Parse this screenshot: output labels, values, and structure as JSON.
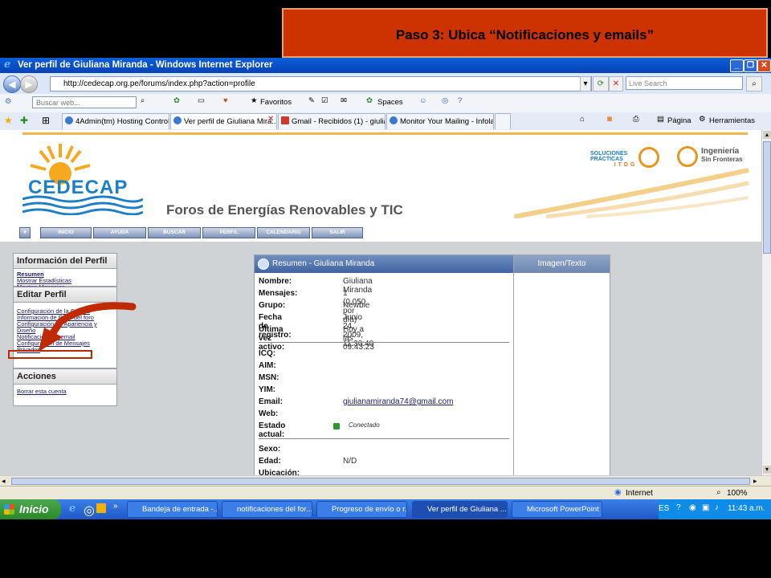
{
  "banner": {
    "text": "Paso 3: Ubica “Notificaciones y emails”"
  },
  "window": {
    "title": "Ver perfil de Giuliana Miranda - Windows Internet Explorer"
  },
  "address": {
    "url": "http://cedecap.org.pe/forums/index.php?action=profile",
    "search_placeholder": "Live Search"
  },
  "toolbar": {
    "search_placeholder": "Buscar web...",
    "favoritos": "Favoritos",
    "spaces": "Spaces"
  },
  "tabs": [
    {
      "label": "4Admin(tm) Hosting Control ..."
    },
    {
      "label": "Ver perfil de Giuliana Mira..."
    },
    {
      "label": "Gmail - Recibidos (1) - giulian..."
    },
    {
      "label": "Monitor Your Mailing - Infolac..."
    }
  ],
  "cmdbar": {
    "pagina": "Página",
    "herramientas": "Herramientas"
  },
  "header": {
    "logo": "CEDECAP",
    "title": "Foros de Energías Renovables y TIC",
    "partner1": "SOLUCIONES PRÁCTICAS",
    "partner1_sub": "ITDG",
    "partner2_line1": "Ingeniería",
    "partner2_line2": "Sin Fronteras"
  },
  "nav": [
    "INICIO",
    "AYUDA",
    "BUSCAR",
    "PERFIL",
    "CALENDARIO",
    "SALIR"
  ],
  "sidebar": {
    "info": {
      "title": "Información del Perfil",
      "links": [
        "Resumen",
        "Mostrar Estadísticas",
        "Mostrar Mensajes"
      ]
    },
    "edit": {
      "title": "Editar Perfil",
      "links": [
        "Configuración de la Cuenta",
        "Información de Perfil del foro",
        "Configuración de Apariencia y",
        "Diseño",
        "Notificaciones y email",
        "Configuración de Mensajes",
        "Privados"
      ]
    },
    "actions": {
      "title": "Acciones",
      "links": [
        "Borrar esta cuenta"
      ]
    }
  },
  "profile": {
    "header": "Resumen - Giuliana Miranda",
    "fields": [
      {
        "k": "Nombre:",
        "v": "Giuliana Miranda"
      },
      {
        "k": "Mensajes:",
        "v": "1 (0.050 por día)"
      },
      {
        "k": "Grupo:",
        "v": "Newbie"
      },
      {
        "k": "Fecha de registro:",
        "v": "Junio 24, 2009, 11:30:40"
      },
      {
        "k": "Última vez activo:",
        "v": "Hoy a las 09:43:23"
      }
    ],
    "contacts": [
      {
        "k": "ICQ:",
        "v": ""
      },
      {
        "k": "AIM:",
        "v": ""
      },
      {
        "k": "MSN:",
        "v": ""
      },
      {
        "k": "YIM:",
        "v": ""
      },
      {
        "k": "Email:",
        "v": "giulianamiranda74@gmail.com"
      },
      {
        "k": "Web:",
        "v": ""
      },
      {
        "k": "Estado actual:",
        "v": "Conectado"
      }
    ],
    "extra": [
      {
        "k": "Sexo:",
        "v": ""
      },
      {
        "k": "Edad:",
        "v": "N/D"
      },
      {
        "k": "Ubicación:",
        "v": ""
      }
    ]
  },
  "imgtext": {
    "header": "Imagen/Texto"
  },
  "status": {
    "zone": "Internet",
    "zoom": "100%"
  },
  "taskbar": {
    "start": "Inicio",
    "tasks": [
      "Bandeja de entrada -...",
      "notificaciones del for...",
      "Progreso de envío o r...",
      "Ver perfil de Giuliana ...",
      "Microsoft PowerPoint ..."
    ],
    "lang": "ES",
    "clock": "11:43 a.m."
  }
}
